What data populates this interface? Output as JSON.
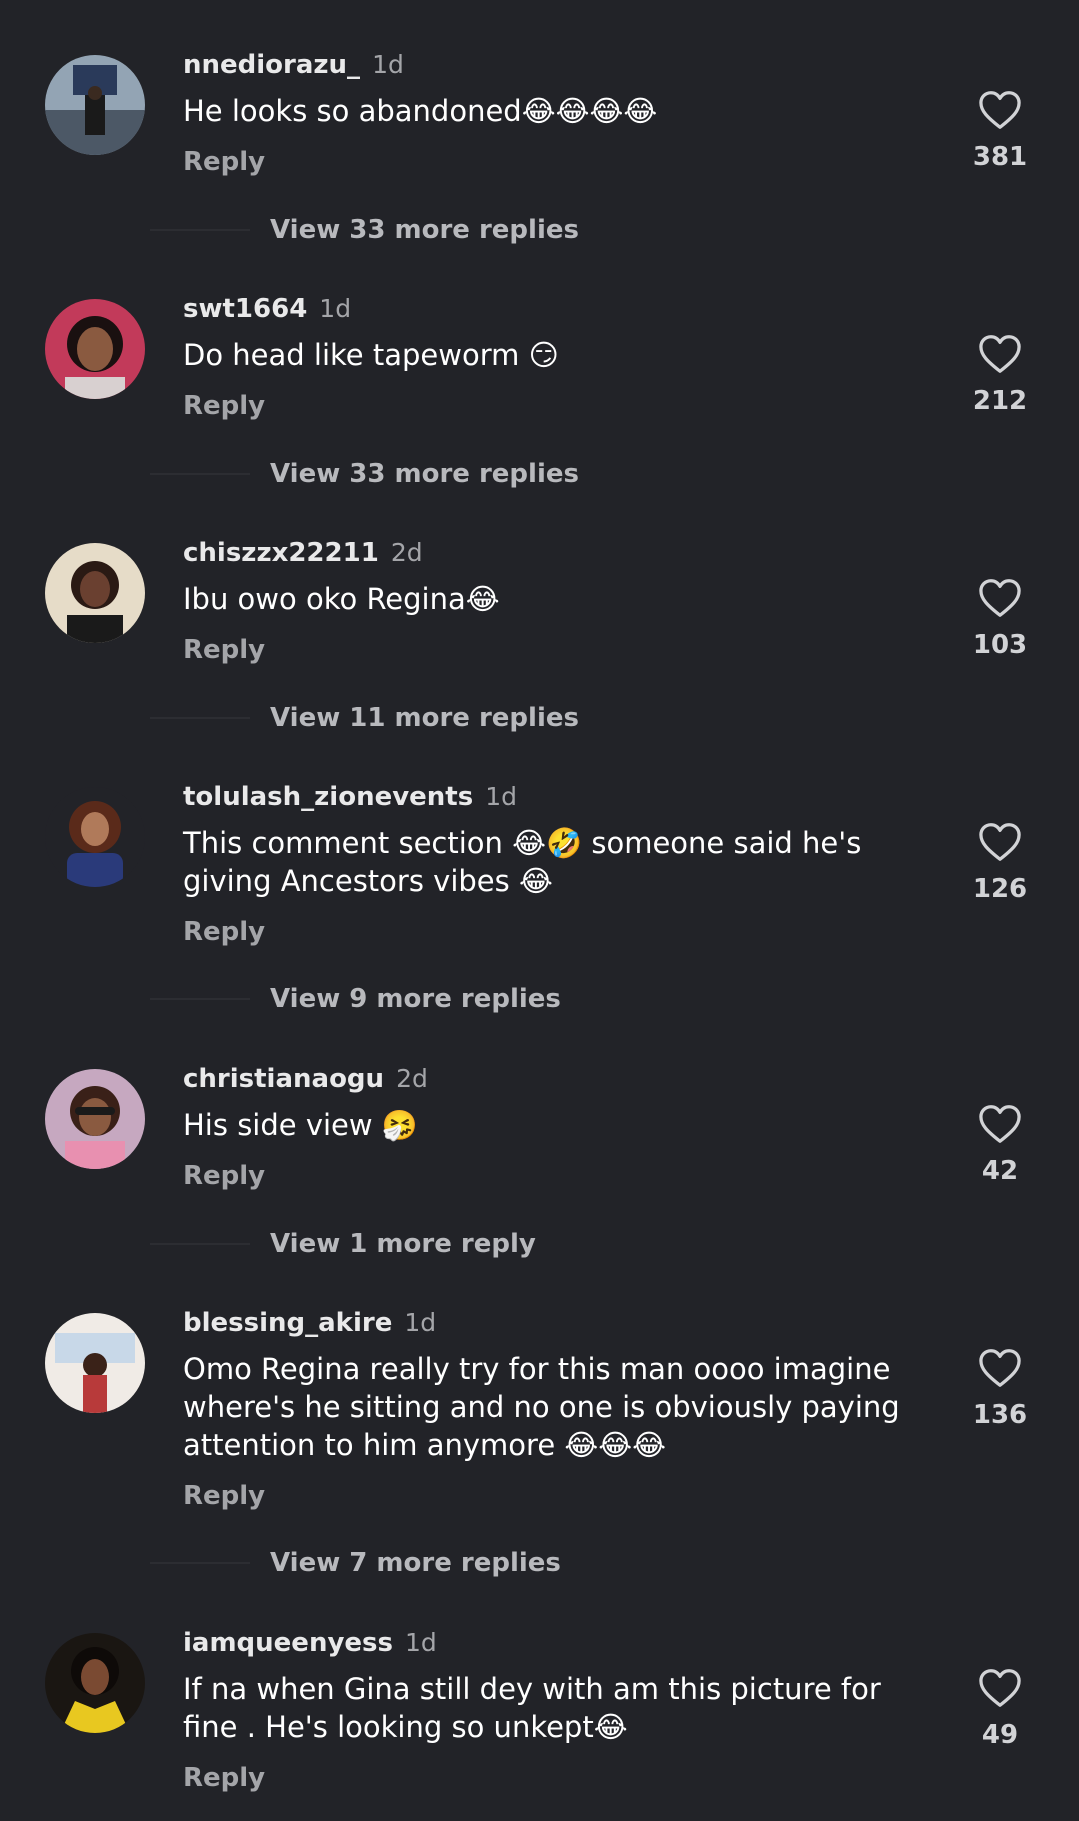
{
  "colors": {
    "background": "#222328",
    "secondary_text": "#a4a5a9",
    "primary_text": "#ffffff"
  },
  "comments": [
    {
      "username": "nnediorazu_",
      "time": "1d",
      "text": "He looks so abandoned😂😂😂😂",
      "reply": "Reply",
      "likes": "381",
      "view_more": "View 33 more replies",
      "avatar_colors": [
        "#4c5866",
        "#9aa8b6"
      ]
    },
    {
      "username": "swt1664",
      "time": "1d",
      "text": "Do head like tapeworm 😏",
      "reply": "Reply",
      "likes": "212",
      "view_more": "View 33 more replies",
      "avatar_colors": [
        "#7a2a3a",
        "#e08aa0"
      ]
    },
    {
      "username": "chiszzx22211",
      "time": "2d",
      "text": "Ibu owo oko Regina😂",
      "reply": "Reply",
      "likes": "103",
      "view_more": "View 11 more replies",
      "avatar_colors": [
        "#d9c8b0",
        "#5a3a2a"
      ]
    },
    {
      "username": "tolulash_zionevents",
      "time": "1d",
      "text": "This comment section 😂🤣 someone said he's giving Ancestors vibes 😂",
      "reply": "Reply",
      "likes": "126",
      "view_more": "View 9 more replies",
      "avatar_colors": [
        "#1e2a4a",
        "#6a3a2a"
      ]
    },
    {
      "username": "christianaogu",
      "time": "2d",
      "text": "His side view 🤧",
      "reply": "Reply",
      "likes": "42",
      "view_more": "View 1 more reply",
      "avatar_colors": [
        "#d9a3b8",
        "#6a4a3a"
      ]
    },
    {
      "username": "blessing_akire",
      "time": "1d",
      "text": "Omo Regina really try for this man oooo imagine where's he sitting and no one is obviously paying attention to him anymore 😂😂😂",
      "reply": "Reply",
      "likes": "136",
      "view_more": "View 7 more replies",
      "avatar_colors": [
        "#f2ece6",
        "#b03a3a"
      ]
    },
    {
      "username": "iamqueenyess",
      "time": "1d",
      "text": "If na when Gina still dey with am this picture for fine . He's looking so unkept😂",
      "reply": "Reply",
      "likes": "49",
      "view_more": "",
      "avatar_colors": [
        "#e0c020",
        "#3a2a20"
      ]
    }
  ]
}
